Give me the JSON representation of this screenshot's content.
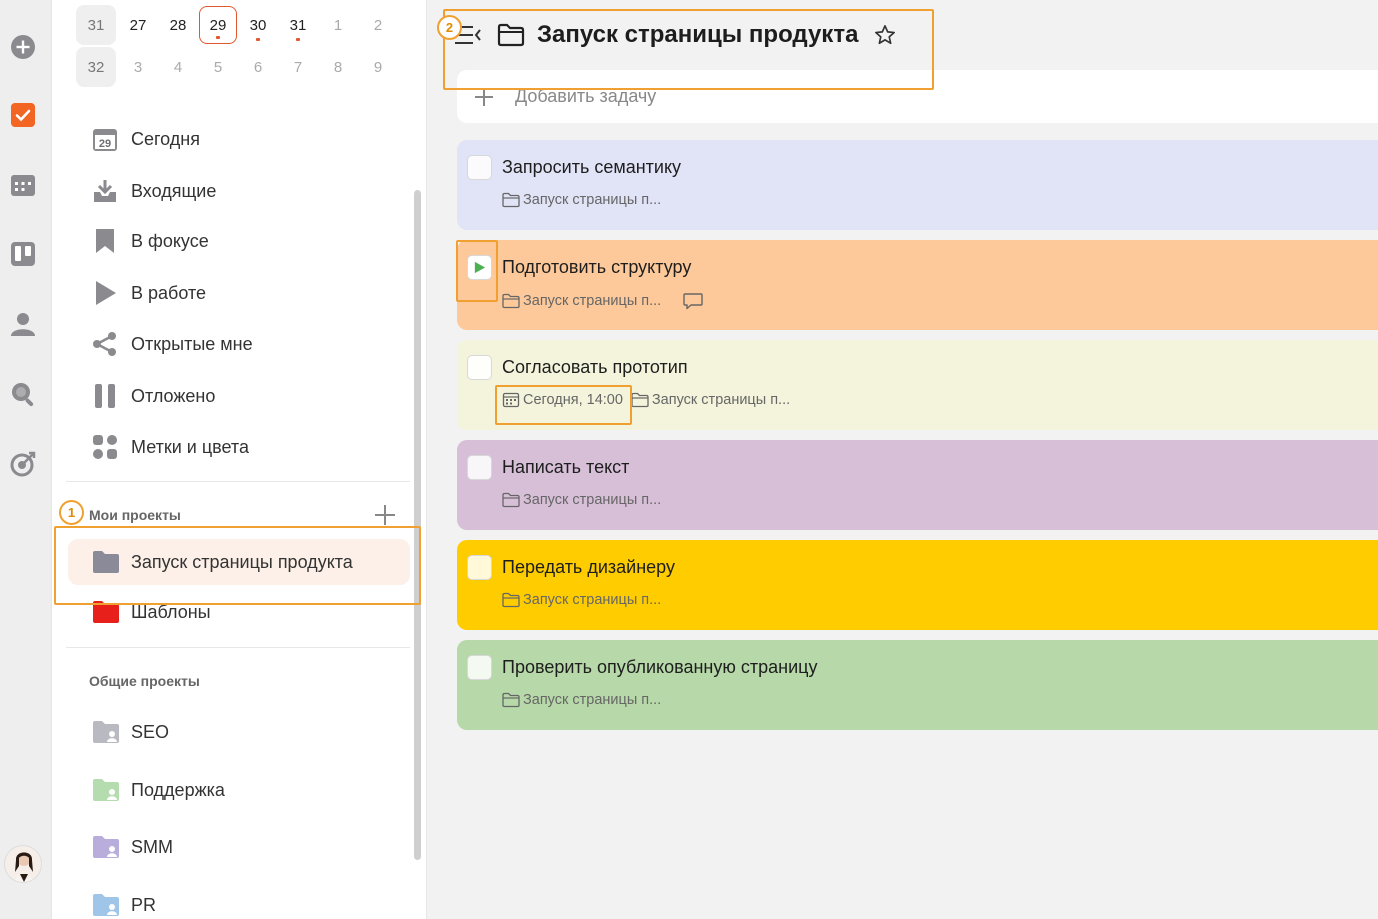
{
  "calendar": {
    "rows": [
      {
        "week": "31",
        "days": [
          {
            "label": "27",
            "muted": false,
            "selected": false,
            "dot": false
          },
          {
            "label": "28",
            "muted": false,
            "selected": false,
            "dot": false
          },
          {
            "label": "29",
            "muted": false,
            "selected": true,
            "dot": true
          },
          {
            "label": "30",
            "muted": false,
            "selected": false,
            "dot": true
          },
          {
            "label": "31",
            "muted": false,
            "selected": false,
            "dot": true
          },
          {
            "label": "1",
            "muted": true,
            "selected": false,
            "dot": false
          },
          {
            "label": "2",
            "muted": true,
            "selected": false,
            "dot": false
          }
        ]
      },
      {
        "week": "32",
        "days": [
          {
            "label": "3",
            "muted": true,
            "selected": false,
            "dot": false
          },
          {
            "label": "4",
            "muted": true,
            "selected": false,
            "dot": false
          },
          {
            "label": "5",
            "muted": true,
            "selected": false,
            "dot": false
          },
          {
            "label": "6",
            "muted": true,
            "selected": false,
            "dot": false
          },
          {
            "label": "7",
            "muted": true,
            "selected": false,
            "dot": false
          },
          {
            "label": "8",
            "muted": true,
            "selected": false,
            "dot": false
          },
          {
            "label": "9",
            "muted": true,
            "selected": false,
            "dot": false
          }
        ]
      }
    ]
  },
  "nav": {
    "items": [
      {
        "label": "Сегодня",
        "icon": "calendar-today-icon",
        "badge": "29"
      },
      {
        "label": "Входящие",
        "icon": "inbox-icon"
      },
      {
        "label": "В фокусе",
        "icon": "bookmark-icon"
      },
      {
        "label": "В работе",
        "icon": "play-icon"
      },
      {
        "label": "Открытые мне",
        "icon": "share-icon"
      },
      {
        "label": "Отложено",
        "icon": "pause-icon"
      },
      {
        "label": "Метки и цвета",
        "icon": "tags-grid-icon"
      }
    ]
  },
  "my_projects": {
    "title": "Мои проекты",
    "items": [
      {
        "label": "Запуск страницы продукта",
        "color": "#8a8a99",
        "active": true
      },
      {
        "label": "Шаблоны",
        "color": "#e8201c",
        "active": false
      }
    ]
  },
  "shared_projects": {
    "title": "Общие проекты",
    "items": [
      {
        "label": "SEO",
        "color": "#b9b9c2"
      },
      {
        "label": "Поддержка",
        "color": "#b5dcae"
      },
      {
        "label": "SMM",
        "color": "#b8addb"
      },
      {
        "label": "PR",
        "color": "#9fc6e8"
      }
    ]
  },
  "main": {
    "title": "Запуск страницы продукта",
    "add_task_placeholder": "Добавить задачу",
    "tasks": [
      {
        "title": "Запросить семантику",
        "project": "Запуск страницы п...",
        "color": "#e1e3f7",
        "state": "empty",
        "date": "",
        "comment": false
      },
      {
        "title": "Подготовить структуру",
        "project": "Запуск страницы п...",
        "color": "#fdc99a",
        "state": "in-progress",
        "date": "",
        "comment": true
      },
      {
        "title": "Согласовать прототип",
        "project": "Запуск страницы п...",
        "color": "#f4f4dc",
        "state": "empty",
        "date": "Сегодня, 14:00",
        "comment": false
      },
      {
        "title": "Написать текст",
        "project": "Запуск страницы п...",
        "color": "#d8bfd8",
        "state": "empty",
        "date": "",
        "comment": false
      },
      {
        "title": "Передать дизайнеру",
        "project": "Запуск страницы п...",
        "color": "#ffcc00",
        "state": "empty",
        "date": "",
        "comment": false
      },
      {
        "title": "Проверить опубликованную страницу",
        "project": "Запуск страницы п...",
        "color": "#b7d8a8",
        "state": "empty",
        "date": "",
        "comment": false
      }
    ]
  },
  "annotations": [
    {
      "label": "1"
    },
    {
      "label": "2"
    }
  ],
  "colors": {
    "accent": "#e4572e",
    "highlight": "#f0a030",
    "play_green": "#4caf50"
  }
}
